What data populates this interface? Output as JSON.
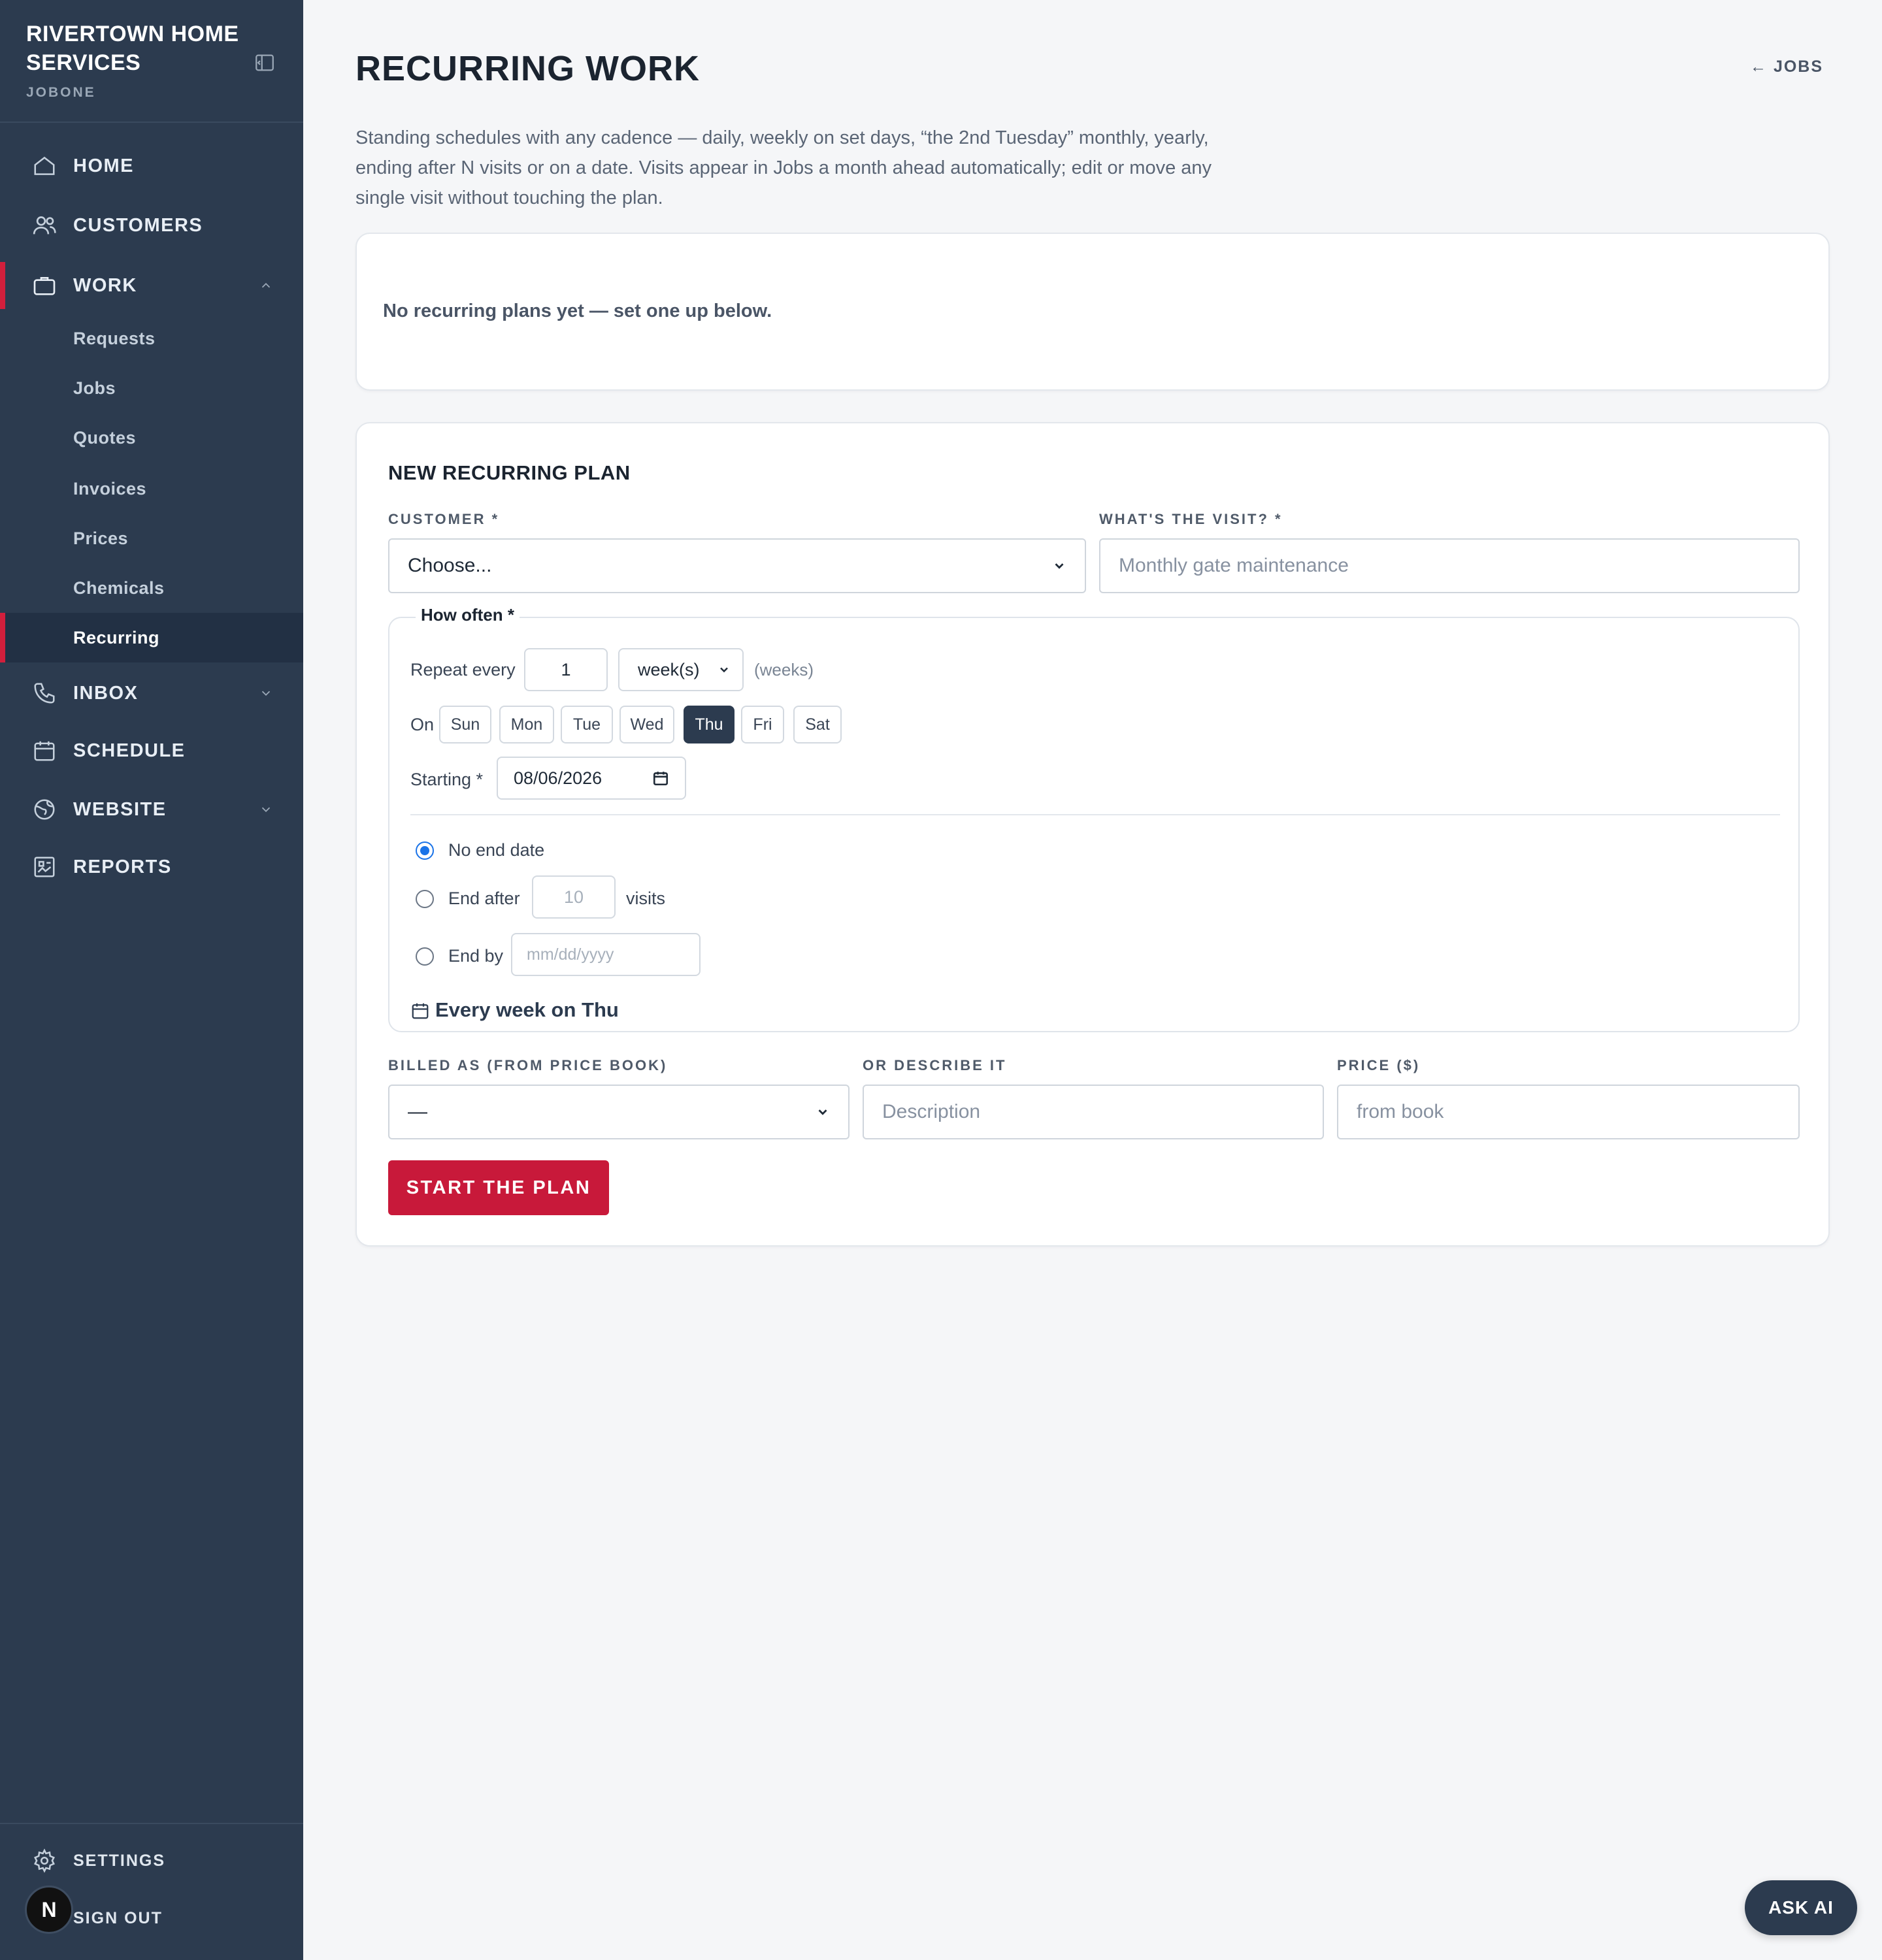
{
  "brand": {
    "name": "RIVERTOWN HOME SERVICES",
    "sub": "JOBONE"
  },
  "nav": {
    "home": "HOME",
    "customers": "CUSTOMERS",
    "work": "WORK",
    "work_items": [
      "Requests",
      "Jobs",
      "Quotes",
      "Invoices",
      "Prices",
      "Chemicals",
      "Recurring"
    ],
    "inbox": "INBOX",
    "schedule": "SCHEDULE",
    "website": "WEBSITE",
    "reports": "REPORTS",
    "settings": "SETTINGS",
    "sign_out": "SIGN OUT",
    "avatar_letter": "N"
  },
  "page": {
    "title": "RECURRING WORK",
    "back_link": "← JOBS",
    "intro": "Standing schedules with any cadence — daily, weekly on set days, “the 2nd Tuesday” monthly, yearly, ending after N visits or on a date. Visits appear in Jobs a month ahead automatically; edit or move any single visit without touching the plan.",
    "empty_state": "No recurring plans yet — set one up below."
  },
  "form": {
    "title": "NEW RECURRING PLAN",
    "customer_label": "CUSTOMER *",
    "customer_value": "Choose...",
    "visit_label": "WHAT'S THE VISIT? *",
    "visit_placeholder": "Monthly gate maintenance",
    "how_often_legend": "How often *",
    "repeat_label": "Repeat every",
    "repeat_value": "1",
    "repeat_unit": "week(s)",
    "repeat_hint": "(weeks)",
    "on_label": "On",
    "days": [
      "Sun",
      "Mon",
      "Tue",
      "Wed",
      "Thu",
      "Fri",
      "Sat"
    ],
    "selected_day": "Thu",
    "starting_label": "Starting *",
    "starting_value": "08/06/2026",
    "end_options": {
      "no_end": "No end date",
      "end_after": "End after",
      "end_after_placeholder": "10",
      "visits": "visits",
      "end_by": "End by",
      "end_by_placeholder": "mm/dd/yyyy"
    },
    "selected_end_option": "no_end",
    "summary": "Every week on Thu",
    "billed_label": "BILLED AS (FROM PRICE BOOK)",
    "billed_value": "—",
    "describe_label": "OR DESCRIBE IT",
    "describe_placeholder": "Description",
    "price_label": "PRICE ($)",
    "price_placeholder": "from book",
    "submit": "START THE PLAN"
  },
  "ask_ai": "ASK AI",
  "colors": {
    "sidebar": "#2c3b4f",
    "accent_red": "#c8193a",
    "selected_day": "#2c3b4f",
    "radio_blue": "#1a73e8"
  }
}
